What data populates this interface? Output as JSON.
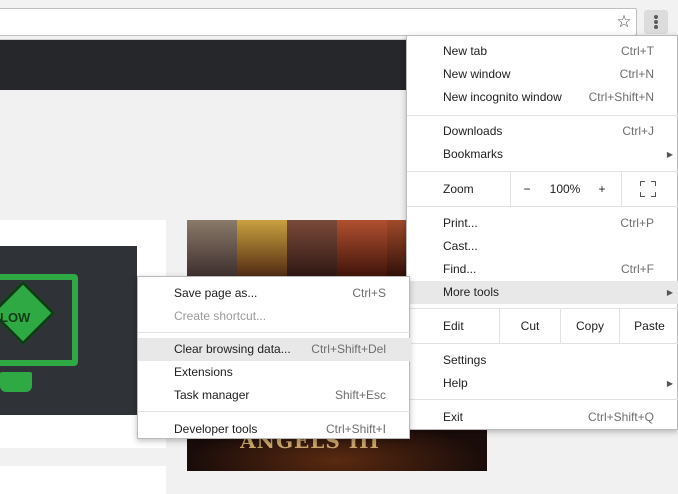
{
  "menu": {
    "items": [
      {
        "label": "New tab",
        "shortcut": "Ctrl+T"
      },
      {
        "label": "New window",
        "shortcut": "Ctrl+N"
      },
      {
        "label": "New incognito window",
        "shortcut": "Ctrl+Shift+N"
      },
      {
        "label": "Downloads",
        "shortcut": "Ctrl+J"
      },
      {
        "label": "Bookmarks",
        "shortcut": ""
      },
      {
        "label": "Print...",
        "shortcut": "Ctrl+P"
      },
      {
        "label": "Cast...",
        "shortcut": ""
      },
      {
        "label": "Find...",
        "shortcut": "Ctrl+F"
      },
      {
        "label": "More tools",
        "shortcut": ""
      },
      {
        "label": "Settings",
        "shortcut": ""
      },
      {
        "label": "Help",
        "shortcut": ""
      },
      {
        "label": "Exit",
        "shortcut": "Ctrl+Shift+Q"
      }
    ],
    "zoom": {
      "label": "Zoom",
      "minus": "−",
      "value": "100%",
      "plus": "+"
    },
    "edit": {
      "label": "Edit",
      "cut": "Cut",
      "copy": "Copy",
      "paste": "Paste"
    }
  },
  "submenu": {
    "items": [
      {
        "label": "Save page as...",
        "shortcut": "Ctrl+S"
      },
      {
        "label": "Create shortcut...",
        "shortcut": ""
      },
      {
        "label": "Clear browsing data...",
        "shortcut": "Ctrl+Shift+Del"
      },
      {
        "label": "Extensions",
        "shortcut": ""
      },
      {
        "label": "Task manager",
        "shortcut": "Shift+Esc"
      },
      {
        "label": "Developer tools",
        "shortcut": "Ctrl+Shift+I"
      }
    ]
  },
  "page": {
    "promo_sign_text": "LOW",
    "game_logo_text": "ANGELS III"
  },
  "colors": {
    "accent_green": "#2fa944",
    "header_dark": "#25272a",
    "menu_highlight": "#e8e8e8"
  },
  "icons": {
    "star": "bookmark-star-icon",
    "menu": "kebab-menu-icon",
    "fullscreen": "fullscreen-icon",
    "submenu_arrow": "chevron-right-icon"
  }
}
